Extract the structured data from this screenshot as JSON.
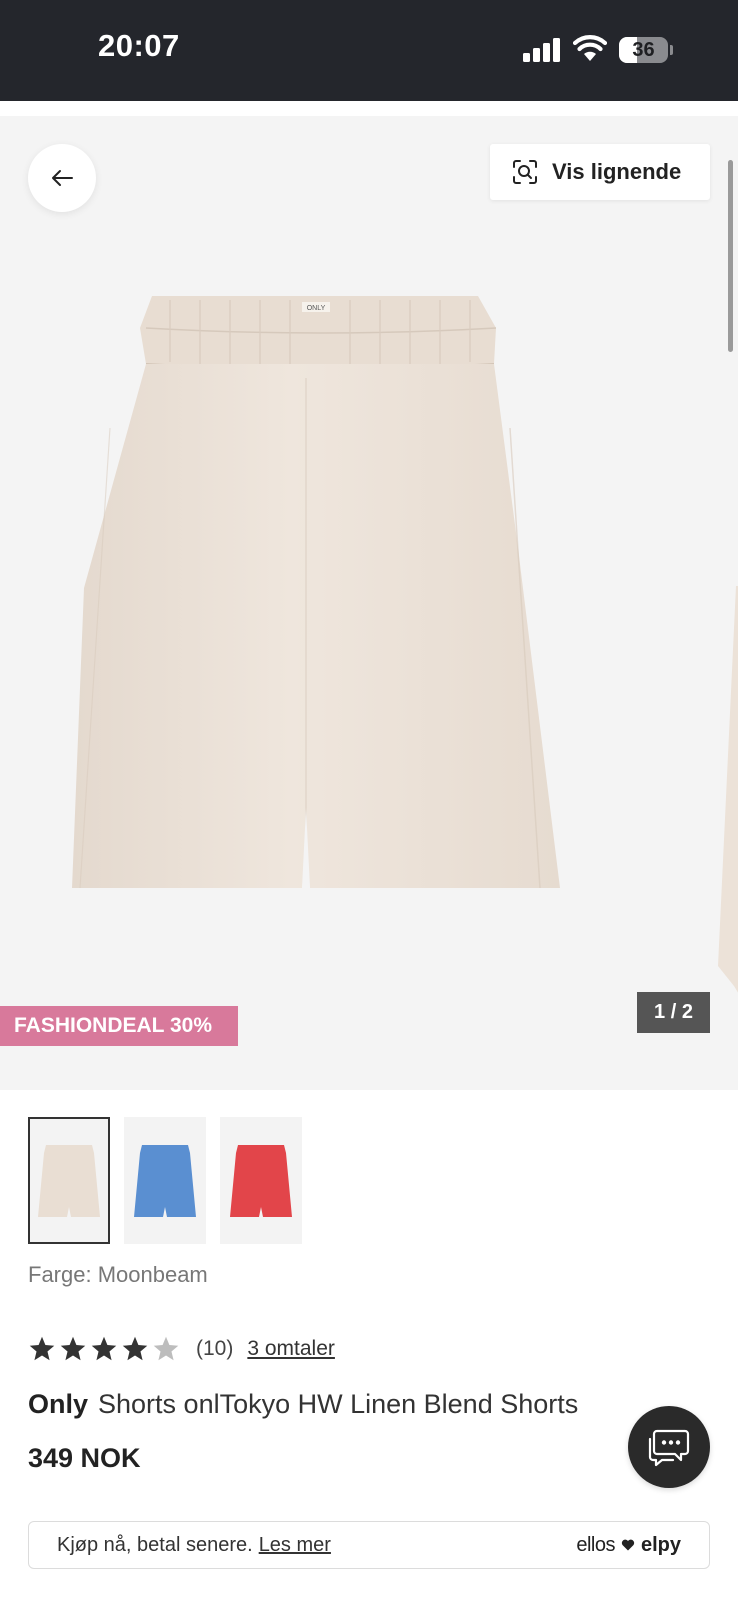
{
  "status_bar": {
    "time": "20:07",
    "battery_level": "36"
  },
  "gallery": {
    "similar_label": "Vis lignende",
    "deal_badge": "FASHIONDEAL 30%",
    "counter": "1 / 2",
    "shorts_label_text": "ONLY"
  },
  "thumbnails": [
    {
      "color": "#e9ded3",
      "selected": true
    },
    {
      "color": "#5a8fd1",
      "selected": false
    },
    {
      "color": "#e2454a",
      "selected": false
    }
  ],
  "product": {
    "color_label": "Farge: Moonbeam",
    "rating": 4,
    "rating_max": 5,
    "rating_count": "(10)",
    "reviews_link": "3 omtaler",
    "brand": "Only",
    "name": "Shorts onlTokyo HW Linen Blend Shorts",
    "price": "349 NOK"
  },
  "bnpl": {
    "text": "Kjøp nå, betal senere.",
    "link": "Les mer",
    "logo_left": "ellos",
    "logo_right": "elpy"
  },
  "colors": {
    "status_bar": "#24262c",
    "gallery_bg": "#f4f4f4",
    "deal_badge": "#d8799b",
    "shorts": "#eae0d6",
    "star_filled": "#333333",
    "star_empty": "#bdbdbd"
  }
}
